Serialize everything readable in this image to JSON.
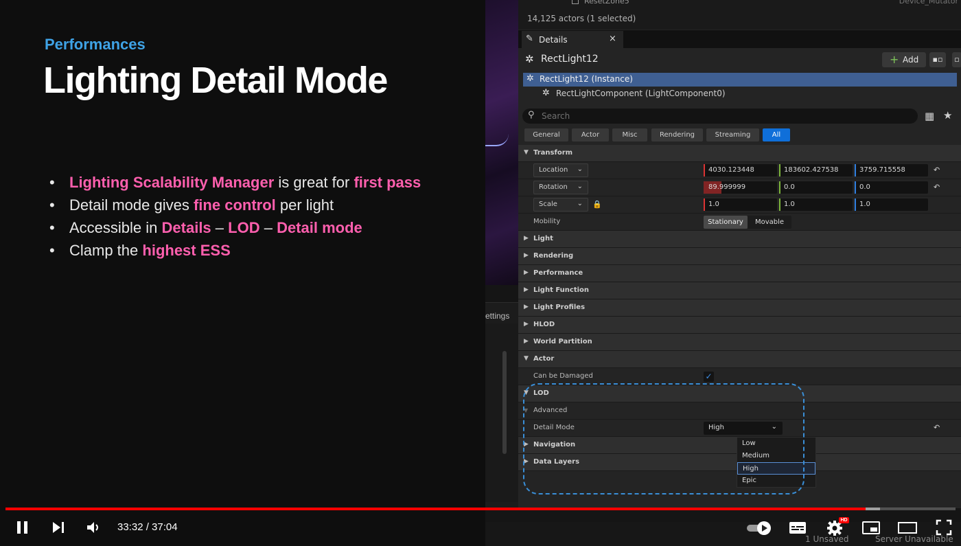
{
  "slide": {
    "kicker": "Performances",
    "title": "Lighting Detail Mode",
    "bullets": [
      [
        {
          "t": "Lighting Scalability Manager",
          "h": true
        },
        {
          "t": " is great for ",
          "h": false
        },
        {
          "t": "first pass",
          "h": true
        }
      ],
      [
        {
          "t": "Detail mode gives ",
          "h": false
        },
        {
          "t": "fine control",
          "h": true
        },
        {
          "t": " per light",
          "h": false
        }
      ],
      [
        {
          "t": "Accessible in ",
          "h": false
        },
        {
          "t": "Details",
          "h": true
        },
        {
          "t": " – ",
          "h": false
        },
        {
          "t": "LOD",
          "h": true
        },
        {
          "t": " – ",
          "h": false
        },
        {
          "t": "Detail mode",
          "h": true
        }
      ],
      [
        {
          "t": "Clamp the ",
          "h": false
        },
        {
          "t": "highest ESS",
          "h": true
        }
      ]
    ]
  },
  "editor": {
    "reset_zone": "ResetZone5",
    "device_mutator": "Device_Mutator",
    "actors_count": "14,125 actors (1 selected)",
    "left_panel_label": "ettings",
    "details_tab": "Details",
    "details_close": "×",
    "actor_name": "RectLight12",
    "add_label": "Add",
    "component_selected": "RectLight12 (Instance)",
    "component_child": "RectLightComponent (LightComponent0)",
    "search_placeholder": "Search",
    "category_tabs": [
      "General",
      "Actor",
      "Misc",
      "Rendering",
      "Streaming",
      "All"
    ],
    "active_category": "All",
    "transform": {
      "section": "Transform",
      "location_label": "Location",
      "location": [
        "4030.123448",
        "183602.427538",
        "3759.715558"
      ],
      "rotation_label": "Rotation",
      "rotation": [
        "89.999999",
        "0.0",
        "0.0"
      ],
      "scale_label": "Scale",
      "scale": [
        "1.0",
        "1.0",
        "1.0"
      ],
      "mobility_label": "Mobility",
      "mobility_options": [
        "Stationary",
        "Movable"
      ],
      "mobility_selected": "Stationary"
    },
    "sections_collapsed": [
      "Light",
      "Rendering",
      "Performance",
      "Light Function",
      "Light Profiles",
      "HLOD",
      "World Partition"
    ],
    "actor_section": "Actor",
    "can_be_damaged_label": "Can be Damaged",
    "can_be_damaged": true,
    "lod_section": "LOD",
    "advanced_label": "Advanced",
    "detail_mode_label": "Detail Mode",
    "detail_mode_value": "High",
    "detail_mode_options": [
      "Low",
      "Medium",
      "High",
      "Epic"
    ],
    "sections_after": [
      "Navigation",
      "Data Layers"
    ],
    "status_unsaved": "1 Unsaved",
    "status_server": "Server Unavailable"
  },
  "player": {
    "time": "33:32 / 37:04",
    "progress": 0.905,
    "buffered": 0.92,
    "controls": [
      "play-pause",
      "next",
      "volume",
      "autoplay",
      "subtitles",
      "settings",
      "miniplayer",
      "theater",
      "fullscreen"
    ],
    "hd_badge": "HD",
    "accent_color": "#ff0000"
  },
  "colors": {
    "highlight_pink": "#ff5fae",
    "kicker_blue": "#3fa3e6",
    "ue_selected": "#3f5f92",
    "ue_active_tab": "#0f6fd9"
  }
}
